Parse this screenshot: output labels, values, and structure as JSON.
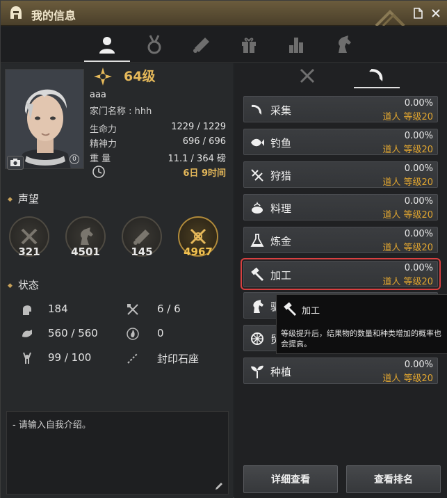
{
  "window": {
    "title": "我的信息"
  },
  "top_tabs": [
    {
      "icon": "person-icon",
      "active": true
    },
    {
      "icon": "medal-icon",
      "active": false
    },
    {
      "icon": "scroll-icon",
      "active": false
    },
    {
      "icon": "gift-icon",
      "active": false
    },
    {
      "icon": "bar-chart-icon",
      "active": false
    },
    {
      "icon": "horse-icon",
      "active": false
    }
  ],
  "profile": {
    "level": "64级",
    "name": "aaa",
    "stats": [
      {
        "label": "家门名称 : hhh",
        "value": ""
      },
      {
        "label": "生命力",
        "value": "1229 / 1229"
      },
      {
        "label": "精神力",
        "value": "696 / 696"
      },
      {
        "label": "重  量",
        "value": "11.1 / 364 磅"
      }
    ],
    "portrait_badge": "0",
    "playtime": "6日 9时间"
  },
  "reputation": {
    "title": "声望",
    "items": [
      {
        "icon": "swords-icon",
        "value": "321",
        "gold": false
      },
      {
        "icon": "horse-head-icon",
        "value": "4501",
        "gold": false
      },
      {
        "icon": "scroll-icon",
        "value": "145",
        "gold": false
      },
      {
        "icon": "crossed-emblem-icon",
        "value": "4967",
        "gold": true
      }
    ]
  },
  "status": {
    "title": "状态",
    "items": [
      {
        "icon": "head-icon",
        "value": "184"
      },
      {
        "icon": "axe-icon",
        "value": "6 / 6"
      },
      {
        "icon": "strength-icon",
        "value": "560 / 560"
      },
      {
        "icon": "flame-icon",
        "value": "0"
      },
      {
        "icon": "wine-icon",
        "value": "99 / 100"
      },
      {
        "icon": "chain-icon",
        "value": "封印石座"
      }
    ]
  },
  "intro": {
    "text": "- 请输入自我介绍。"
  },
  "sub_tabs": [
    {
      "icon": "crossed-swords-icon",
      "active": false
    },
    {
      "icon": "sickle-icon",
      "active": true
    }
  ],
  "skills": [
    {
      "icon": "sickle-icon",
      "name": "采集",
      "pct": "0.00%",
      "level": "道人 等级20",
      "selected": false
    },
    {
      "icon": "fish-icon",
      "name": "钓鱼",
      "pct": "0.00%",
      "level": "道人 等级20",
      "selected": false
    },
    {
      "icon": "crossbow-icon",
      "name": "狩猎",
      "pct": "0.00%",
      "level": "道人 等级20",
      "selected": false
    },
    {
      "icon": "pot-icon",
      "name": "料理",
      "pct": "0.00%",
      "level": "道人 等级20",
      "selected": false
    },
    {
      "icon": "flask-icon",
      "name": "炼金",
      "pct": "0.00%",
      "level": "道人 等级20",
      "selected": false
    },
    {
      "icon": "hammer-icon",
      "name": "加工",
      "pct": "0.00%",
      "level": "道人 等级20",
      "selected": true
    },
    {
      "icon": "horse-icon",
      "name": "驯",
      "pct": "",
      "level": "",
      "selected": false
    },
    {
      "icon": "wheel-icon",
      "name": "贸",
      "pct": "",
      "level": "",
      "selected": false
    },
    {
      "icon": "sprout-icon",
      "name": "种植",
      "pct": "0.00%",
      "level": "道人 等级20",
      "selected": false
    }
  ],
  "buttons": {
    "detail": "详细查看",
    "ranking": "查看排名"
  },
  "tooltip": {
    "title": "加工",
    "body": "等级提升后，结果物的数量和种类增加的概率也会提高。"
  },
  "colors": {
    "gold": "#e6b95a",
    "level_orange": "#e0a530",
    "highlight_red": "#d84040"
  }
}
